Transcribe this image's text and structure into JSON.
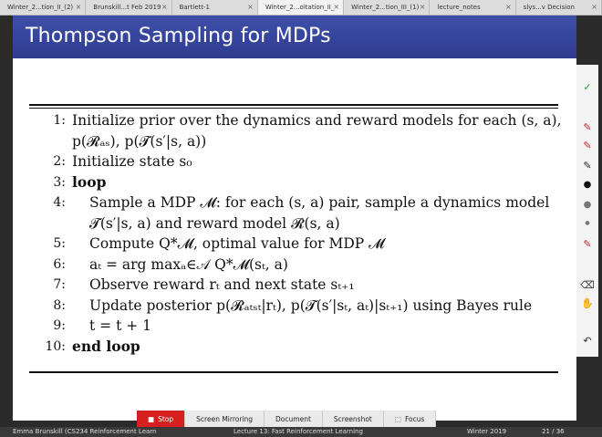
{
  "tabs": [
    {
      "label": "Winter_2...tion_II_(2)"
    },
    {
      "label": "Brunskill...t Feb 2019"
    },
    {
      "label": "Bartlett-1"
    },
    {
      "label": "Winter_2...oitation_II_"
    },
    {
      "label": "Winter_2...tion_III_(1)"
    },
    {
      "label": "lecture_notes"
    },
    {
      "label": "slys...v Decision"
    }
  ],
  "slide": {
    "title": "Thompson Sampling for MDPs"
  },
  "algorithm": [
    {
      "num": "1:",
      "text": "Initialize prior over the dynamics and reward models for each (s, a),"
    },
    {
      "num": "",
      "text": "p(𝓡ₐₛ), p(𝓣(s′|s, a))"
    },
    {
      "num": "2:",
      "text": "Initialize state s₀"
    },
    {
      "num": "3:",
      "text": "loop"
    },
    {
      "num": "4:",
      "text": "Sample a MDP 𝓜: for each (s, a) pair, sample a dynamics model"
    },
    {
      "num": "",
      "text": "𝓣(s′|s, a) and reward model 𝓡(s, a)"
    },
    {
      "num": "5:",
      "text": "Compute Q*𝓜, optimal value for MDP 𝓜"
    },
    {
      "num": "6:",
      "text": "aₜ = arg maxₐ∈𝒜 Q*𝓜(sₜ, a)"
    },
    {
      "num": "7:",
      "text": "Observe reward rₜ and next state sₜ₊₁"
    },
    {
      "num": "8:",
      "text": "Update posterior p(𝓡ₐₜₛₜ|rₜ), p(𝓣(s′|sₜ, aₜ)|sₜ₊₁) using Bayes rule"
    },
    {
      "num": "9:",
      "text": "t = t + 1"
    },
    {
      "num": "10:",
      "text": "end loop"
    }
  ],
  "toolbar_icons": [
    "check-icon",
    "pen-red-icon",
    "pen-red-icon",
    "pen-black-icon",
    "dot-black-icon",
    "dot-gray-icon",
    "dot-small-icon",
    "pen-red-icon",
    "eraser-icon",
    "hand-icon",
    "undo-icon"
  ],
  "bottom_buttons": {
    "stop": "Stop",
    "screen_mirroring": "Screen Mirroring",
    "document": "Document",
    "screenshot": "Screenshot",
    "focus": "Focus"
  },
  "footer": {
    "left": "Emma Brunskill (CS234 Reinforcement Learn",
    "center": "Lecture 13: Fast Reinforcement Learning",
    "term": "Winter 2019",
    "page": "21 / 36"
  },
  "colors": {
    "title_bar": "#3344a0",
    "stop": "#d71f1f"
  }
}
